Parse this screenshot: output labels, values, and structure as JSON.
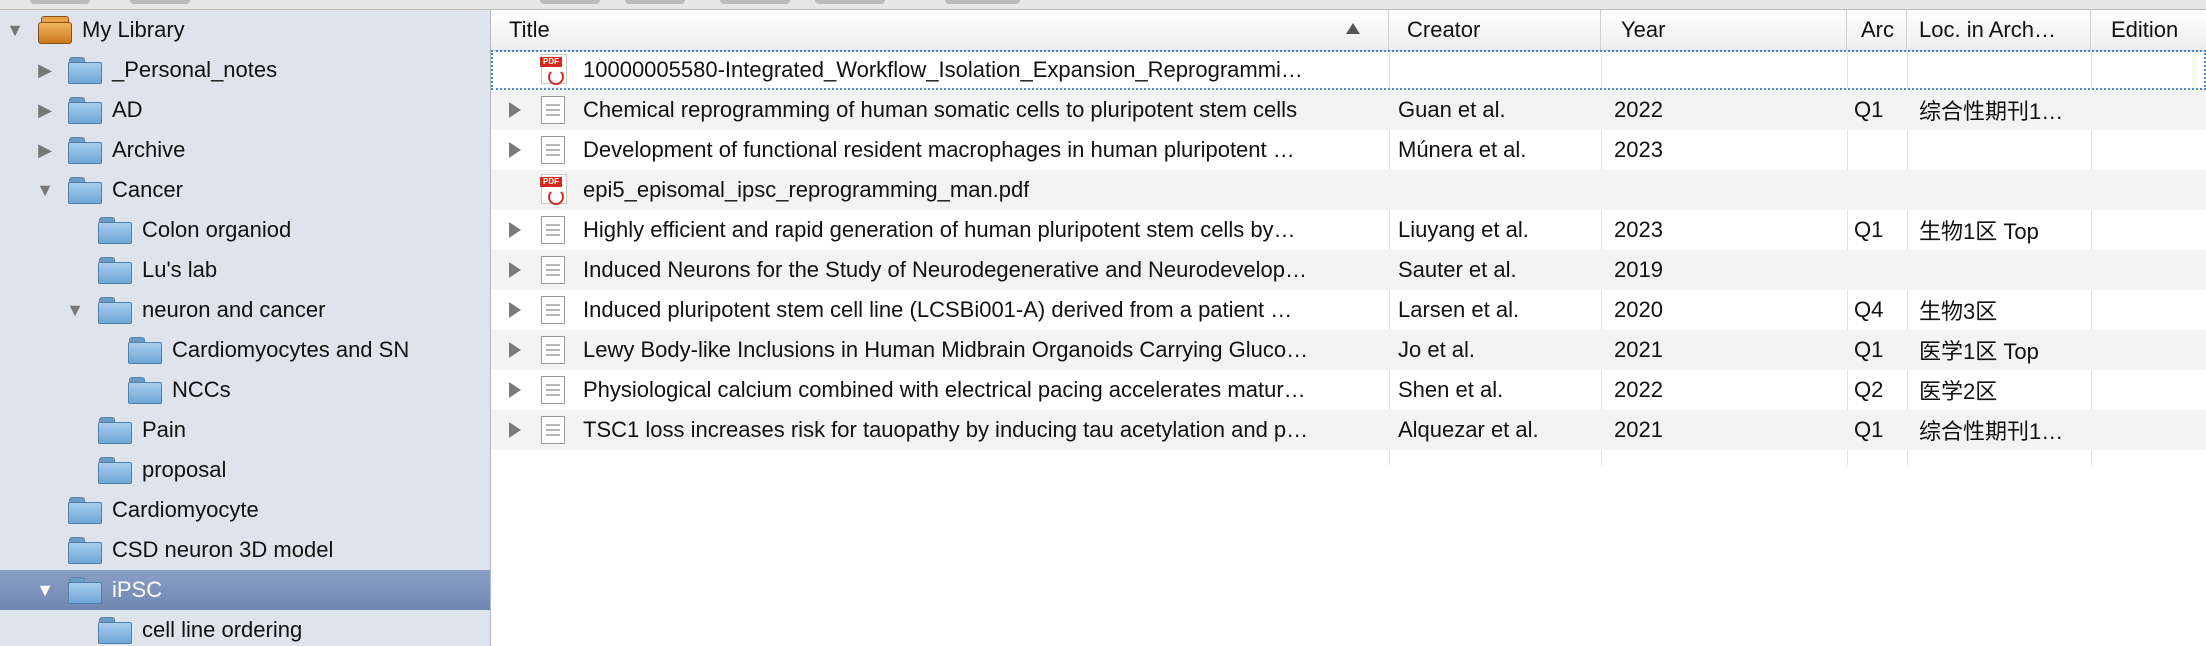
{
  "sidebar": {
    "items": [
      {
        "label": "My Library",
        "icon": "library-icon",
        "expanded": true,
        "selected": false
      },
      {
        "label": "_Personal_notes",
        "icon": "folder-icon",
        "expanded": false,
        "selected": false
      },
      {
        "label": "AD",
        "icon": "folder-icon",
        "expanded": false,
        "selected": false
      },
      {
        "label": "Archive",
        "icon": "folder-icon",
        "expanded": false,
        "selected": false
      },
      {
        "label": "Cancer",
        "icon": "folder-icon",
        "expanded": true,
        "selected": false
      },
      {
        "label": "Colon organiod",
        "icon": "folder-icon",
        "expanded": null,
        "selected": false
      },
      {
        "label": "Lu's lab",
        "icon": "folder-icon",
        "expanded": null,
        "selected": false
      },
      {
        "label": "neuron and cancer",
        "icon": "folder-icon",
        "expanded": true,
        "selected": false
      },
      {
        "label": "Cardiomyocytes and SN",
        "icon": "folder-icon",
        "expanded": null,
        "selected": false
      },
      {
        "label": "NCCs",
        "icon": "folder-icon",
        "expanded": null,
        "selected": false
      },
      {
        "label": "Pain",
        "icon": "folder-icon",
        "expanded": null,
        "selected": false
      },
      {
        "label": "proposal",
        "icon": "folder-icon",
        "expanded": null,
        "selected": false
      },
      {
        "label": "Cardiomyocyte",
        "icon": "folder-icon",
        "expanded": null,
        "selected": false
      },
      {
        "label": "CSD neuron 3D model",
        "icon": "folder-icon",
        "expanded": null,
        "selected": false
      },
      {
        "label": "iPSC",
        "icon": "folder-icon",
        "expanded": true,
        "selected": true
      },
      {
        "label": "cell line ordering",
        "icon": "folder-icon",
        "expanded": null,
        "selected": false
      }
    ]
  },
  "table": {
    "columns": {
      "title": "Title",
      "creator": "Creator",
      "year": "Year",
      "arc": "Arc",
      "loc": "Loc. in Arch…",
      "edition": "Edition"
    },
    "sort": {
      "column": "title",
      "direction": "ascending"
    },
    "rows": [
      {
        "type": "pdf",
        "title": "10000005580-Integrated_Workflow_Isolation_Expansion_Reprogrammi…",
        "creator": "",
        "year": "",
        "arc": "",
        "loc": "",
        "edition": ""
      },
      {
        "type": "doc",
        "title": "Chemical reprogramming of human somatic cells to pluripotent stem cells",
        "creator": "Guan et al.",
        "year": "2022",
        "arc": "Q1",
        "loc": "综合性期刊1…",
        "edition": ""
      },
      {
        "type": "doc",
        "title": "Development of functional resident macrophages in human pluripotent …",
        "creator": "Múnera et al.",
        "year": "2023",
        "arc": "",
        "loc": "",
        "edition": ""
      },
      {
        "type": "pdf",
        "title": "epi5_episomal_ipsc_reprogramming_man.pdf",
        "creator": "",
        "year": "",
        "arc": "",
        "loc": "",
        "edition": ""
      },
      {
        "type": "doc",
        "title": "Highly efficient and rapid generation of human pluripotent stem cells by…",
        "creator": "Liuyang et al.",
        "year": "2023",
        "arc": "Q1",
        "loc": "生物1区 Top",
        "edition": ""
      },
      {
        "type": "doc",
        "title": "Induced Neurons for the Study of Neurodegenerative and Neurodevelop…",
        "creator": "Sauter et al.",
        "year": "2019",
        "arc": "",
        "loc": "",
        "edition": ""
      },
      {
        "type": "doc",
        "title": "Induced pluripotent stem cell line (LCSBi001-A) derived from a patient …",
        "creator": "Larsen et al.",
        "year": "2020",
        "arc": "Q4",
        "loc": "生物3区",
        "edition": ""
      },
      {
        "type": "doc",
        "title": "Lewy Body-like Inclusions in Human Midbrain Organoids Carrying Gluco…",
        "creator": "Jo et al.",
        "year": "2021",
        "arc": "Q1",
        "loc": "医学1区 Top",
        "edition": ""
      },
      {
        "type": "doc",
        "title": "Physiological calcium combined with electrical pacing accelerates matur…",
        "creator": "Shen et al.",
        "year": "2022",
        "arc": "Q2",
        "loc": "医学2区",
        "edition": ""
      },
      {
        "type": "doc",
        "title": "TSC1 loss increases risk for tauopathy by inducing tau acetylation and p…",
        "creator": "Alquezar et al.",
        "year": "2021",
        "arc": "Q1",
        "loc": "综合性期刊1…",
        "edition": ""
      }
    ]
  }
}
